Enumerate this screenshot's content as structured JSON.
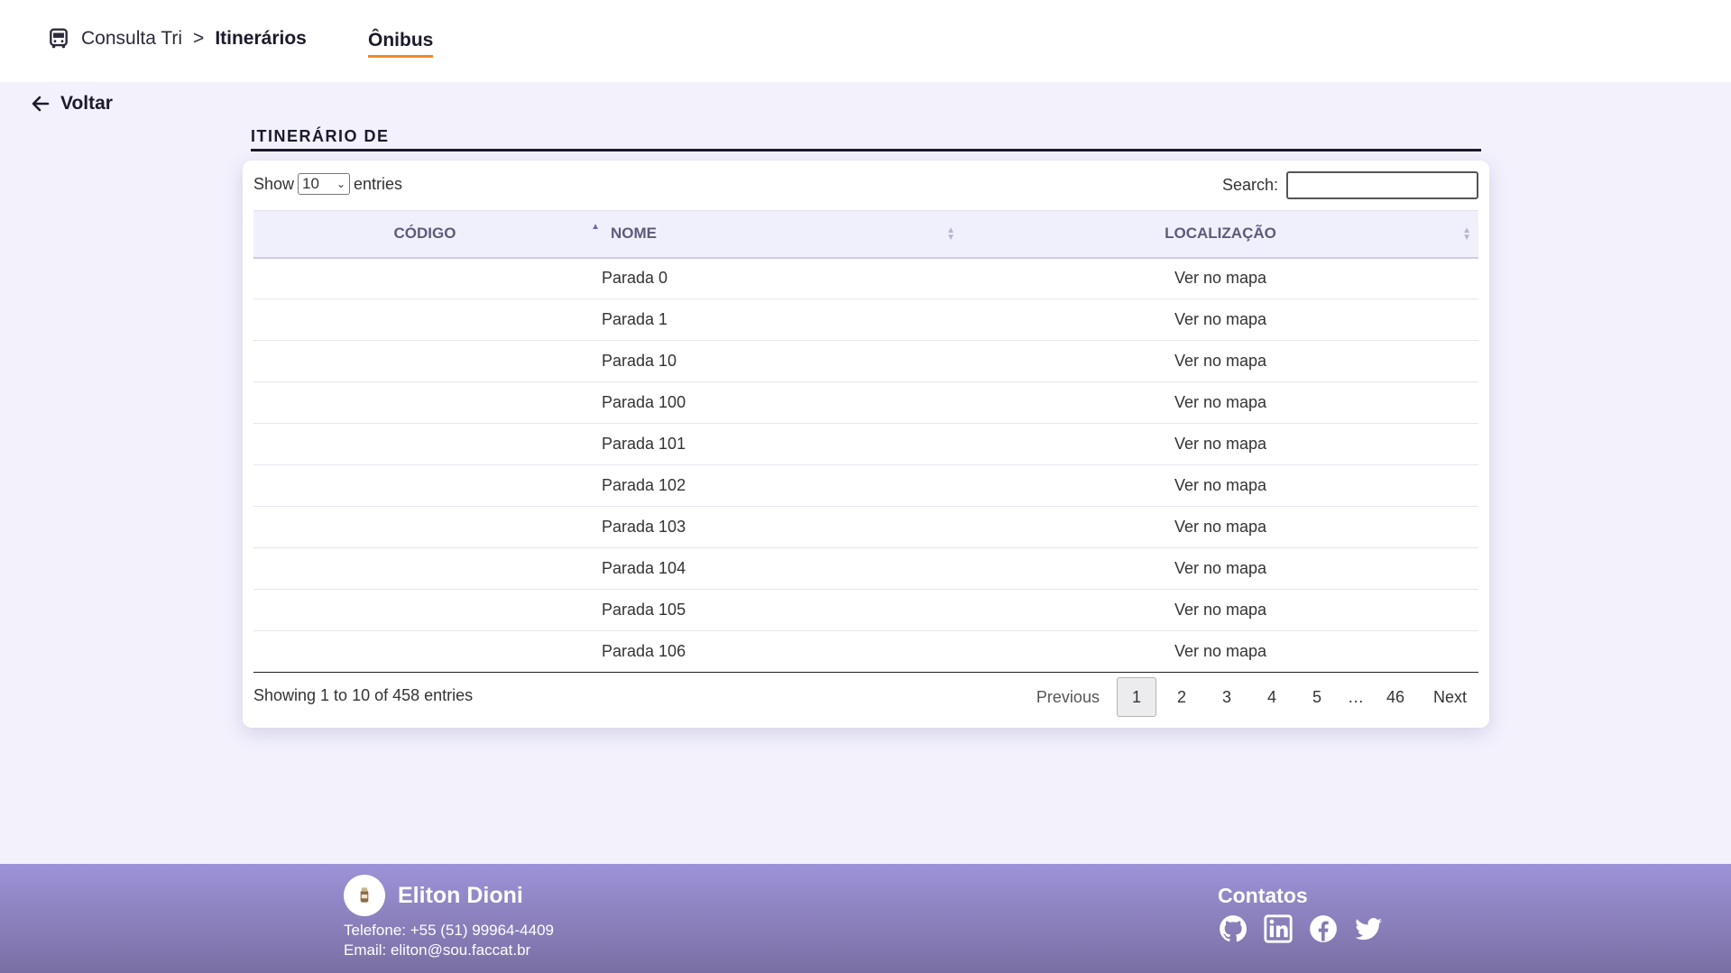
{
  "header": {
    "app_name": "Consulta Tri",
    "separator": ">",
    "current_page": "Itinerários",
    "nav_tab": "Ônibus"
  },
  "back_label": "Voltar",
  "section_title": "ITINERÁRIO DE",
  "table_controls": {
    "show_label": "Show",
    "entries_label": "entries",
    "page_length": "10",
    "search_label": "Search:",
    "search_value": ""
  },
  "columns": [
    "CÓDIGO",
    "NOME",
    "LOCALIZAÇÃO"
  ],
  "rows": [
    {
      "codigo": "",
      "nome": "Parada 0",
      "localizacao": "Ver no mapa"
    },
    {
      "codigo": "",
      "nome": "Parada 1",
      "localizacao": "Ver no mapa"
    },
    {
      "codigo": "",
      "nome": "Parada 10",
      "localizacao": "Ver no mapa"
    },
    {
      "codigo": "",
      "nome": "Parada 100",
      "localizacao": "Ver no mapa"
    },
    {
      "codigo": "",
      "nome": "Parada 101",
      "localizacao": "Ver no mapa"
    },
    {
      "codigo": "",
      "nome": "Parada 102",
      "localizacao": "Ver no mapa"
    },
    {
      "codigo": "",
      "nome": "Parada 103",
      "localizacao": "Ver no mapa"
    },
    {
      "codigo": "",
      "nome": "Parada 104",
      "localizacao": "Ver no mapa"
    },
    {
      "codigo": "",
      "nome": "Parada 105",
      "localizacao": "Ver no mapa"
    },
    {
      "codigo": "",
      "nome": "Parada 106",
      "localizacao": "Ver no mapa"
    }
  ],
  "table_info": "Showing 1 to 10 of 458 entries",
  "pagination": {
    "previous": "Previous",
    "pages": [
      "1",
      "2",
      "3",
      "4",
      "5"
    ],
    "ellipsis": "…",
    "last_page": "46",
    "next": "Next",
    "current": "1"
  },
  "footer": {
    "author_name": "Eliton Dioni",
    "phone": "Telefone: +55 (51) 99964-4409",
    "email": "Email: eliton@sou.faccat.br",
    "contacts_title": "Contatos",
    "contact_icons": [
      "github-icon",
      "linkedin-icon",
      "facebook-icon",
      "twitter-icon"
    ]
  },
  "colors": {
    "accent_underline": "#f08a24",
    "page_background": "#f2f1fc",
    "footer_gradient_top": "#9d93d8",
    "footer_gradient_bottom": "#7a6fa3",
    "header_text": "#5e5a7a"
  }
}
